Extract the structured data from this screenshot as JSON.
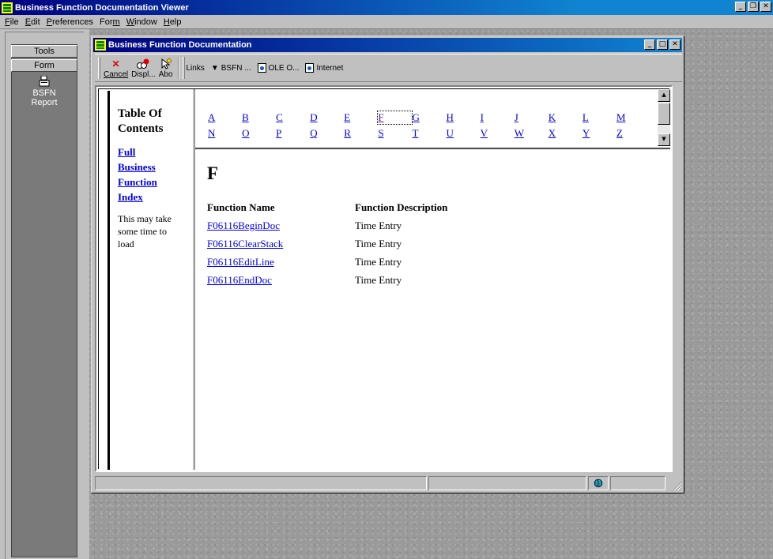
{
  "app": {
    "title": "Business Function Documentation Viewer"
  },
  "menu": {
    "items": [
      {
        "label": "File",
        "mnemonic": "F"
      },
      {
        "label": "Edit",
        "mnemonic": "E"
      },
      {
        "label": "Preferences",
        "mnemonic": "P"
      },
      {
        "label": "Form",
        "mnemonic": "m"
      },
      {
        "label": "Window",
        "mnemonic": "W"
      },
      {
        "label": "Help",
        "mnemonic": "H"
      }
    ]
  },
  "rail": {
    "tools_label": "Tools",
    "form_label": "Form",
    "report_label_line1": "BSFN",
    "report_label_line2": "Report",
    "report_icon": "report-icon"
  },
  "child": {
    "title": "Business Function Documentation"
  },
  "toolbar": {
    "cancel_label": "Cancel",
    "display_label": "Displ...",
    "about_label": "Abo",
    "links_label": "Links",
    "bsfn_label": "BSFN ...",
    "ole_label": "OLE O...",
    "internet_label": "Internet"
  },
  "toc": {
    "title_line1": "Table Of",
    "title_line2": "Contents",
    "link_lines": [
      "Full",
      "Business",
      "Function",
      "Index"
    ],
    "note": "This may take some time to load"
  },
  "alphabet": {
    "row1": [
      "A",
      "B",
      "C",
      "D",
      "E",
      "F",
      "G",
      "H",
      "I",
      "J",
      "K",
      "L",
      "M"
    ],
    "row2": [
      "N",
      "O",
      "P",
      "Q",
      "R",
      "S",
      "T",
      "U",
      "V",
      "W",
      "X",
      "Y",
      "Z"
    ],
    "selected": "F"
  },
  "main": {
    "heading": "F",
    "col_name": "Function Name",
    "col_desc": "Function Description",
    "rows": [
      {
        "name": "F06116BeginDoc",
        "desc": "Time Entry"
      },
      {
        "name": "F06116ClearStack",
        "desc": "Time Entry"
      },
      {
        "name": "F06116EditLine",
        "desc": "Time Entry"
      },
      {
        "name": "F06116EndDoc",
        "desc": "Time Entry"
      }
    ]
  },
  "colors": {
    "title_active": "#000080",
    "link": "#0000ee",
    "desktop": "#9a9a9a",
    "chrome": "#c0c0c0"
  }
}
